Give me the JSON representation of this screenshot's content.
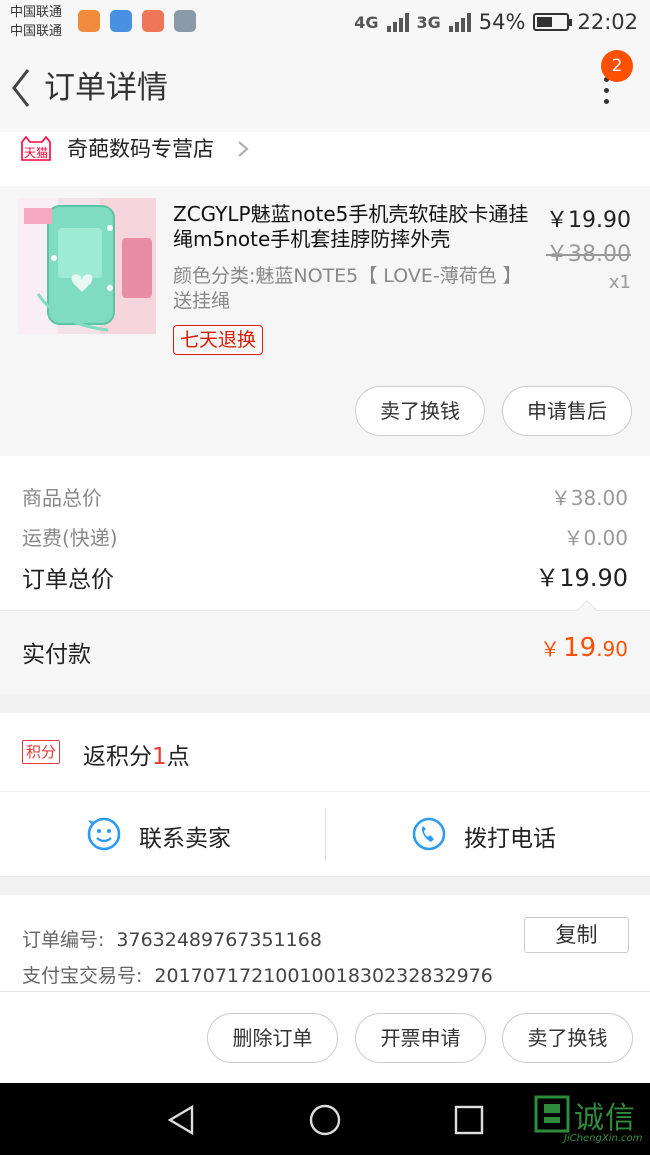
{
  "status_bar": {
    "carrier_1": "中国联通",
    "carrier_2": "中国联通",
    "network_1": "4G",
    "network_2": "3G",
    "battery": "54%",
    "battery_level": 0.54,
    "time": "22:02"
  },
  "header": {
    "title": "订单详情",
    "badge_count": "2"
  },
  "shop": {
    "badge": "天猫",
    "name": "奇葩数码专营店"
  },
  "product": {
    "name": "ZCGYLP魅蓝note5手机壳软硅胶卡通挂绳m5note手机套挂脖防摔外壳",
    "variant": "颜色分类:魅蓝NOTE5【 LOVE-薄荷色 】送挂绳",
    "price": "￥19.90",
    "original_price": "￥38.00",
    "quantity": "x1",
    "tag": "七天退换",
    "buttons": {
      "sell": "卖了换钱",
      "after_sale": "申请售后"
    }
  },
  "totals": {
    "goods_label": "商品总价",
    "goods_value": "￥38.00",
    "shipping_label": "运费(快递)",
    "shipping_value": "￥0.00",
    "order_label": "订单总价",
    "order_value": "￥19.90",
    "paid_label": "实付款",
    "paid_currency": "￥",
    "paid_int": "19",
    "paid_dec": ".90"
  },
  "points": {
    "tag": "积分",
    "prefix": "返积分",
    "number": "1",
    "suffix": "点"
  },
  "contact": {
    "seller": "联系卖家",
    "call": "拨打电话"
  },
  "order_info": {
    "order_no_label": "订单编号:",
    "order_no": "37632489767351168",
    "alipay_label": "支付宝交易号:",
    "alipay_no": "2017071721001001830232832976",
    "copy": "复制"
  },
  "actions": {
    "delete": "删除订单",
    "invoice": "开票申请",
    "sell": "卖了换钱"
  },
  "watermark": {
    "text": "诚信",
    "sub": "JiChengXin.com"
  },
  "colors": {
    "accent": "#ff5000",
    "tmall_red": "#ff0036",
    "contact_blue": "#2d9bf0"
  }
}
